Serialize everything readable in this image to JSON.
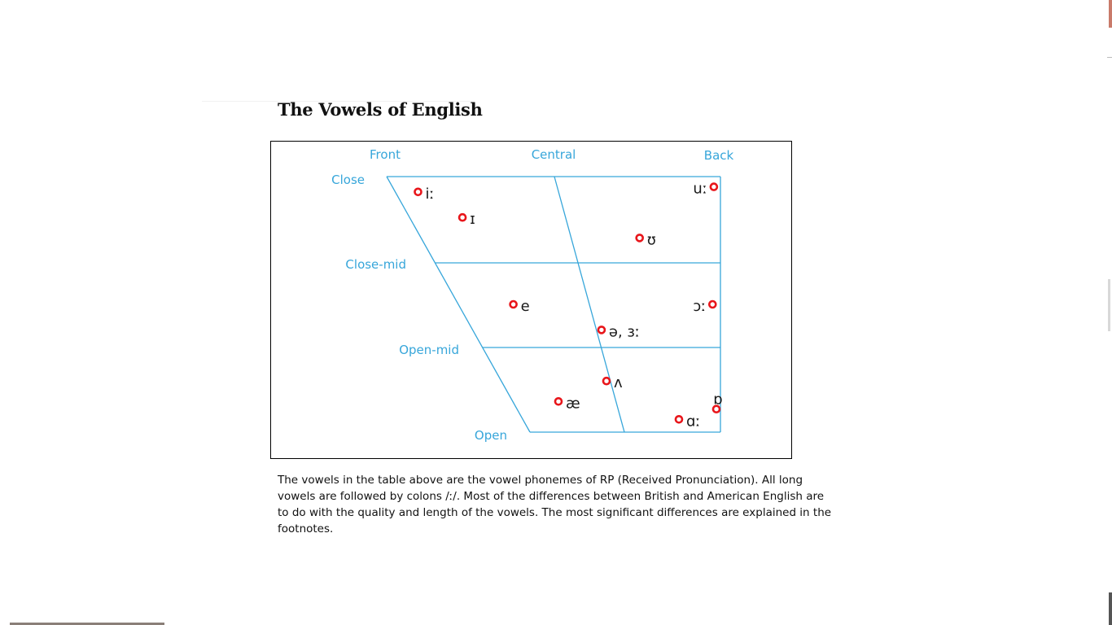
{
  "page": {
    "title": "The Vowels of English",
    "caption_lines": [
      "The vowels in the table above are the vowel phonemes of RP (Received Pronunciation). All long",
      "vowels are followed by colons /ː/. Most of the differences between British and American English are",
      "to do with the quality and length of the vowels. The most significant differences are explained in the",
      "footnotes."
    ]
  },
  "chart": {
    "column_labels": [
      "Front",
      "Central",
      "Back"
    ],
    "row_labels": [
      "Close",
      "Close-mid",
      "Open-mid",
      "Open"
    ],
    "line_color": "#37a6da",
    "marker_color": "#e8161b",
    "vowels": [
      {
        "symbol": "iː",
        "frontness": 0.07,
        "height": 0.06,
        "label_side": "right"
      },
      {
        "symbol": "ɪ",
        "frontness": 0.17,
        "height": 0.16,
        "label_side": "right"
      },
      {
        "symbol": "ʊ",
        "frontness": 0.73,
        "height": 0.24,
        "label_side": "right"
      },
      {
        "symbol": "uː",
        "frontness": 0.98,
        "height": 0.04,
        "label_side": "left"
      },
      {
        "symbol": "e",
        "frontness": 0.21,
        "height": 0.5,
        "label_side": "right"
      },
      {
        "symbol": "ə, ɜː",
        "frontness": 0.52,
        "height": 0.6,
        "label_side": "right"
      },
      {
        "symbol": "ɔː",
        "frontness": 0.97,
        "height": 0.5,
        "label_side": "left"
      },
      {
        "symbol": "ʌ",
        "frontness": 0.48,
        "height": 0.8,
        "label_side": "right"
      },
      {
        "symbol": "æ",
        "frontness": 0.22,
        "height": 0.88,
        "label_side": "right"
      },
      {
        "symbol": "ɑː",
        "frontness": 0.79,
        "height": 0.95,
        "label_side": "right"
      },
      {
        "symbol": "ɒ",
        "frontness": 0.98,
        "height": 0.91,
        "label_side": "above"
      }
    ]
  }
}
